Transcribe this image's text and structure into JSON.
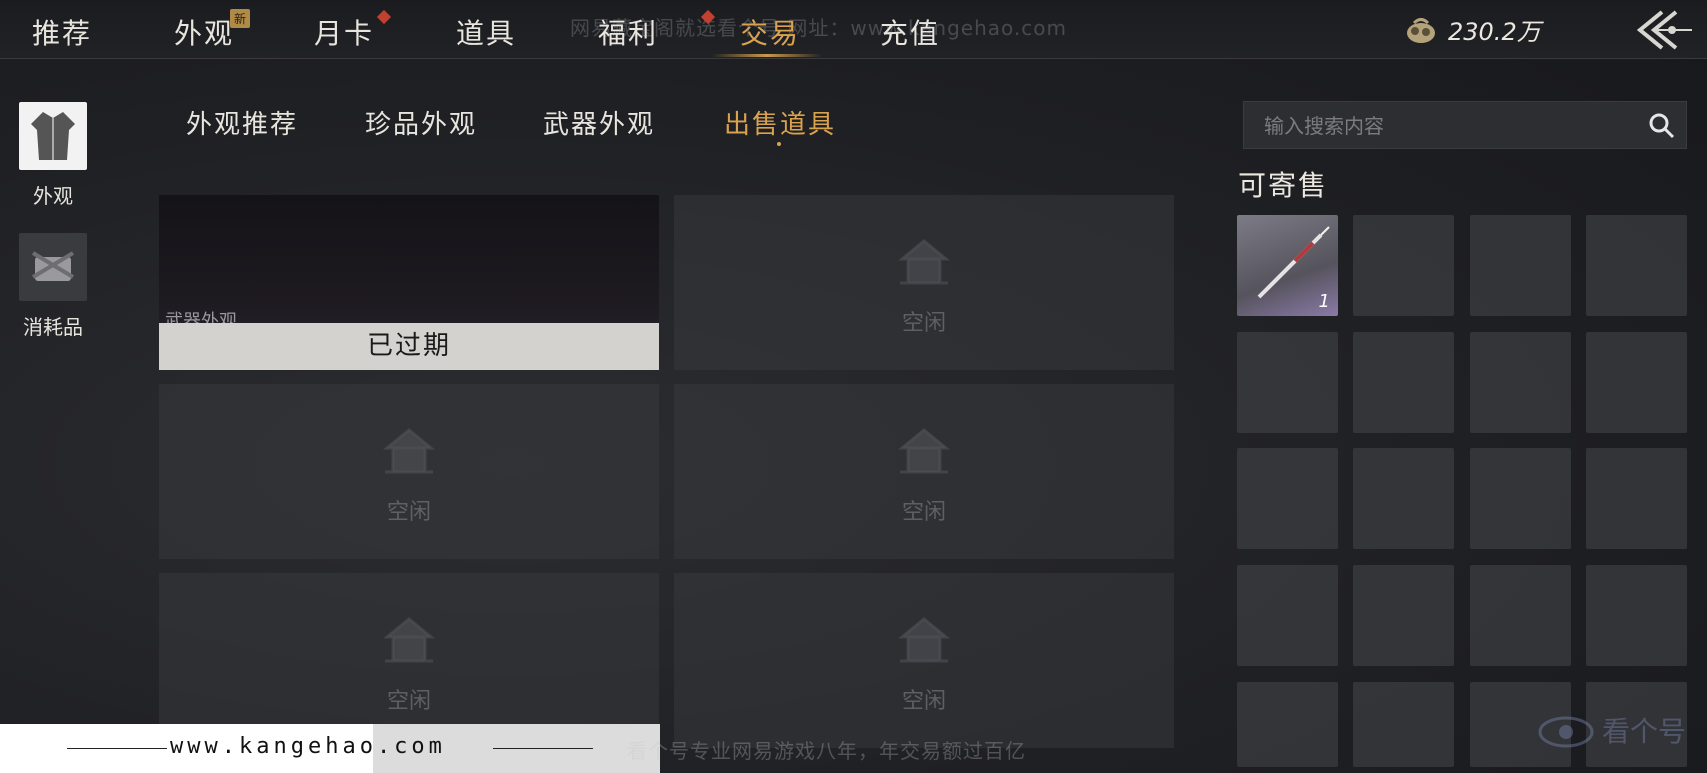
{
  "nav": {
    "items": [
      {
        "label": "推荐"
      },
      {
        "label": "外观"
      },
      {
        "label": "月卡"
      },
      {
        "label": "道具"
      },
      {
        "label": "福利"
      },
      {
        "label": "交易"
      },
      {
        "label": "充值"
      }
    ],
    "active": "交易",
    "new_badge": "新",
    "watermark": "网易藏宝阁就选看个号  网址：www.kangehao.com"
  },
  "currency": {
    "amount": "230.2万",
    "icon": "coin-pouch-icon"
  },
  "left_rail": {
    "items": [
      {
        "label": "外观",
        "icon": "robe-icon"
      },
      {
        "label": "消耗品",
        "icon": "consumable-icon"
      }
    ]
  },
  "sub_tabs": {
    "items": [
      {
        "label": "外观推荐"
      },
      {
        "label": "珍品外观"
      },
      {
        "label": "武器外观"
      },
      {
        "label": "出售道具"
      }
    ],
    "active": "出售道具"
  },
  "listing_slots": {
    "expired": {
      "type_label": "武器外观",
      "status": "已过期"
    },
    "empty_label": "空闲"
  },
  "search": {
    "placeholder": "输入搜索内容"
  },
  "sellable": {
    "title": "可寄售",
    "first_item_count": "1"
  },
  "footer": {
    "url": "www.kangehao.com",
    "slogan": "看个号专业网易游戏八年，年交易额过百亿",
    "logo_text": "看个号"
  },
  "colors": {
    "accent": "#d9a24e",
    "badge": "#b08a47",
    "diamond": "#c2402f"
  }
}
